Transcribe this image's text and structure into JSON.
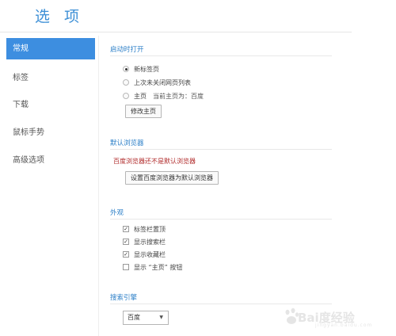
{
  "page": {
    "title": "选 项"
  },
  "sidebar": {
    "items": [
      {
        "label": "常规",
        "active": true
      },
      {
        "label": "标签",
        "active": false
      },
      {
        "label": "下载",
        "active": false
      },
      {
        "label": "鼠标手势",
        "active": false
      },
      {
        "label": "高级选项",
        "active": false
      }
    ]
  },
  "startup": {
    "title": "启动时打开",
    "options": [
      {
        "label": "新标签页",
        "checked": true
      },
      {
        "label": "上次未关闭网页列表",
        "checked": false
      },
      {
        "label": "主页",
        "checked": false
      }
    ],
    "homepage_hint": "当前主页为：百度",
    "edit_home_button": "修改主页"
  },
  "default_browser": {
    "title": "默认浏览器",
    "warning": "百度浏览器还不是默认浏览器",
    "set_default_button": "设置百度浏览器为默认浏览器"
  },
  "appearance": {
    "title": "外观",
    "options": [
      {
        "label": "标签栏置顶",
        "checked": true
      },
      {
        "label": "显示搜索栏",
        "checked": true
      },
      {
        "label": "显示收藏栏",
        "checked": true
      },
      {
        "label": "显示 “主页” 按钮",
        "checked": false
      }
    ]
  },
  "search_engine": {
    "title": "搜索引擎",
    "selected": "百度"
  },
  "watermark": {
    "text": "Bai度经验",
    "sub": "jingyan.baidu.com"
  },
  "colors": {
    "accent": "#3d8ee0",
    "section_title": "#2e80c8",
    "warning": "#b02a2a"
  }
}
